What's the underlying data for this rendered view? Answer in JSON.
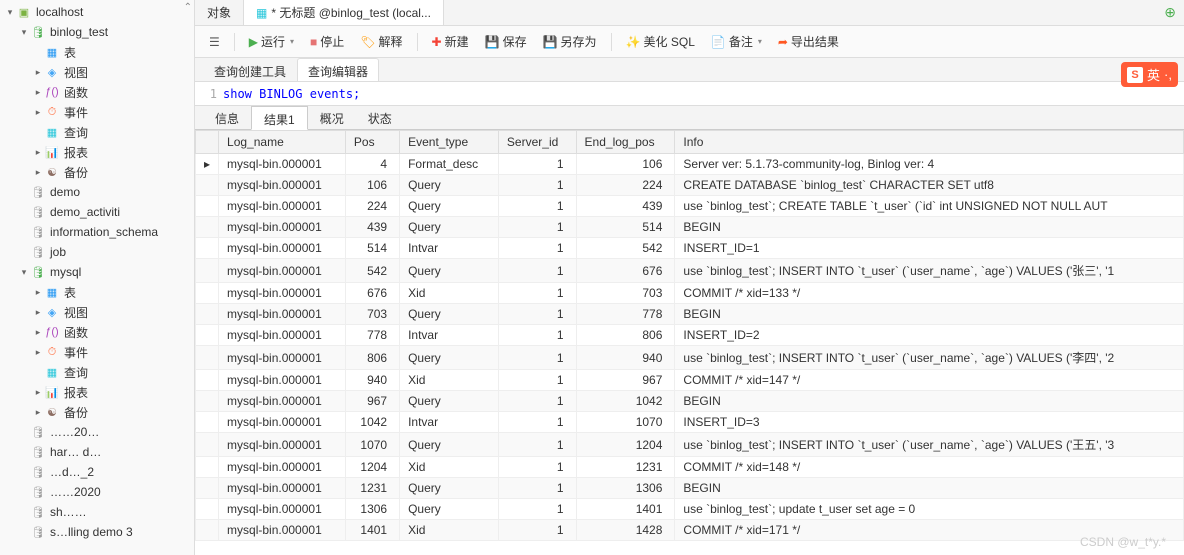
{
  "sidebar": {
    "root": "localhost",
    "tree": [
      {
        "depth": 0,
        "exp": "▾",
        "icon": "ic-server",
        "name": "localhost"
      },
      {
        "depth": 1,
        "exp": "▾",
        "icon": "ic-db",
        "name": "binlog_test"
      },
      {
        "depth": 2,
        "exp": "",
        "icon": "ic-table",
        "name": "表"
      },
      {
        "depth": 2,
        "exp": "▸",
        "icon": "ic-view",
        "name": "视图"
      },
      {
        "depth": 2,
        "exp": "▸",
        "icon": "ic-func",
        "name": "函数"
      },
      {
        "depth": 2,
        "exp": "▸",
        "icon": "ic-event",
        "name": "事件"
      },
      {
        "depth": 2,
        "exp": "",
        "icon": "ic-query",
        "name": "查询"
      },
      {
        "depth": 2,
        "exp": "▸",
        "icon": "ic-report",
        "name": "报表"
      },
      {
        "depth": 2,
        "exp": "▸",
        "icon": "ic-backup",
        "name": "备份"
      },
      {
        "depth": 1,
        "exp": "",
        "icon": "ic-dbgray",
        "name": "demo"
      },
      {
        "depth": 1,
        "exp": "",
        "icon": "ic-dbgray",
        "name": "demo_activiti"
      },
      {
        "depth": 1,
        "exp": "",
        "icon": "ic-dbgray",
        "name": "information_schema"
      },
      {
        "depth": 1,
        "exp": "",
        "icon": "ic-dbgray",
        "name": "job"
      },
      {
        "depth": 1,
        "exp": "▾",
        "icon": "ic-db",
        "name": "mysql"
      },
      {
        "depth": 2,
        "exp": "▸",
        "icon": "ic-table",
        "name": "表"
      },
      {
        "depth": 2,
        "exp": "▸",
        "icon": "ic-view",
        "name": "视图"
      },
      {
        "depth": 2,
        "exp": "▸",
        "icon": "ic-func",
        "name": "函数"
      },
      {
        "depth": 2,
        "exp": "▸",
        "icon": "ic-event",
        "name": "事件"
      },
      {
        "depth": 2,
        "exp": "",
        "icon": "ic-query",
        "name": "查询"
      },
      {
        "depth": 2,
        "exp": "▸",
        "icon": "ic-report",
        "name": "报表"
      },
      {
        "depth": 2,
        "exp": "▸",
        "icon": "ic-backup",
        "name": "备份"
      },
      {
        "depth": 1,
        "exp": "",
        "icon": "ic-dbgray",
        "name": "……20…"
      },
      {
        "depth": 1,
        "exp": "",
        "icon": "ic-dbgray",
        "name": "har… d…"
      },
      {
        "depth": 1,
        "exp": "",
        "icon": "ic-dbgray",
        "name": "…d…_2"
      },
      {
        "depth": 1,
        "exp": "",
        "icon": "ic-dbgray",
        "name": "……2020"
      },
      {
        "depth": 1,
        "exp": "",
        "icon": "ic-dbgray",
        "name": "sh……"
      },
      {
        "depth": 1,
        "exp": "",
        "icon": "ic-dbgray",
        "name": "s…lling demo 3"
      }
    ]
  },
  "docTabs": {
    "tabs": [
      {
        "label": "对象",
        "active": false
      },
      {
        "label": "* 无标题 @binlog_test (local...",
        "active": true,
        "dirty": true
      }
    ]
  },
  "toolbar": {
    "run": "运行",
    "stop": "停止",
    "explain": "解释",
    "new": "新建",
    "save": "保存",
    "saveas": "另存为",
    "beautify": "美化 SQL",
    "note": "备注",
    "export": "导出结果"
  },
  "subTabs": {
    "builder": "查询创建工具",
    "editor": "查询编辑器"
  },
  "code": {
    "line": "1",
    "sql_kw": "show",
    "sql_rest": "BINLOG events;"
  },
  "resultTabs": {
    "info": "信息",
    "result": "结果1",
    "profile": "概况",
    "status": "状态"
  },
  "grid": {
    "columns": [
      "Log_name",
      "Pos",
      "Event_type",
      "Server_id",
      "End_log_pos",
      "Info"
    ],
    "rows": [
      {
        "marker": "▸",
        "c": [
          "mysql-bin.000001",
          "4",
          "Format_desc",
          "1",
          "106",
          "Server ver: 5.1.73-community-log, Binlog ver: 4"
        ]
      },
      {
        "marker": "",
        "c": [
          "mysql-bin.000001",
          "106",
          "Query",
          "1",
          "224",
          "CREATE DATABASE `binlog_test` CHARACTER SET utf8"
        ]
      },
      {
        "marker": "",
        "c": [
          "mysql-bin.000001",
          "224",
          "Query",
          "1",
          "439",
          "use `binlog_test`; CREATE TABLE `t_user` (`id` int UNSIGNED NOT NULL AUT"
        ]
      },
      {
        "marker": "",
        "c": [
          "mysql-bin.000001",
          "439",
          "Query",
          "1",
          "514",
          "BEGIN"
        ]
      },
      {
        "marker": "",
        "c": [
          "mysql-bin.000001",
          "514",
          "Intvar",
          "1",
          "542",
          "INSERT_ID=1"
        ]
      },
      {
        "marker": "",
        "c": [
          "mysql-bin.000001",
          "542",
          "Query",
          "1",
          "676",
          "use `binlog_test`; INSERT INTO `t_user` (`user_name`, `age`) VALUES ('张三', '1"
        ]
      },
      {
        "marker": "",
        "c": [
          "mysql-bin.000001",
          "676",
          "Xid",
          "1",
          "703",
          "COMMIT /* xid=133 */"
        ]
      },
      {
        "marker": "",
        "c": [
          "mysql-bin.000001",
          "703",
          "Query",
          "1",
          "778",
          "BEGIN"
        ]
      },
      {
        "marker": "",
        "c": [
          "mysql-bin.000001",
          "778",
          "Intvar",
          "1",
          "806",
          "INSERT_ID=2"
        ]
      },
      {
        "marker": "",
        "c": [
          "mysql-bin.000001",
          "806",
          "Query",
          "1",
          "940",
          "use `binlog_test`; INSERT INTO `t_user` (`user_name`, `age`) VALUES ('李四', '2"
        ]
      },
      {
        "marker": "",
        "c": [
          "mysql-bin.000001",
          "940",
          "Xid",
          "1",
          "967",
          "COMMIT /* xid=147 */"
        ]
      },
      {
        "marker": "",
        "c": [
          "mysql-bin.000001",
          "967",
          "Query",
          "1",
          "1042",
          "BEGIN"
        ]
      },
      {
        "marker": "",
        "c": [
          "mysql-bin.000001",
          "1042",
          "Intvar",
          "1",
          "1070",
          "INSERT_ID=3"
        ]
      },
      {
        "marker": "",
        "c": [
          "mysql-bin.000001",
          "1070",
          "Query",
          "1",
          "1204",
          "use `binlog_test`; INSERT INTO `t_user` (`user_name`, `age`) VALUES ('王五', '3"
        ]
      },
      {
        "marker": "",
        "c": [
          "mysql-bin.000001",
          "1204",
          "Xid",
          "1",
          "1231",
          "COMMIT /* xid=148 */"
        ]
      },
      {
        "marker": "",
        "c": [
          "mysql-bin.000001",
          "1231",
          "Query",
          "1",
          "1306",
          "BEGIN"
        ]
      },
      {
        "marker": "",
        "c": [
          "mysql-bin.000001",
          "1306",
          "Query",
          "1",
          "1401",
          "use `binlog_test`; update t_user set age = 0"
        ]
      },
      {
        "marker": "",
        "c": [
          "mysql-bin.000001",
          "1401",
          "Xid",
          "1",
          "1428",
          "COMMIT /* xid=171 */"
        ]
      }
    ]
  },
  "ime": {
    "badge": "S",
    "label": "英"
  },
  "watermark": "CSDN @w_t*y.*"
}
